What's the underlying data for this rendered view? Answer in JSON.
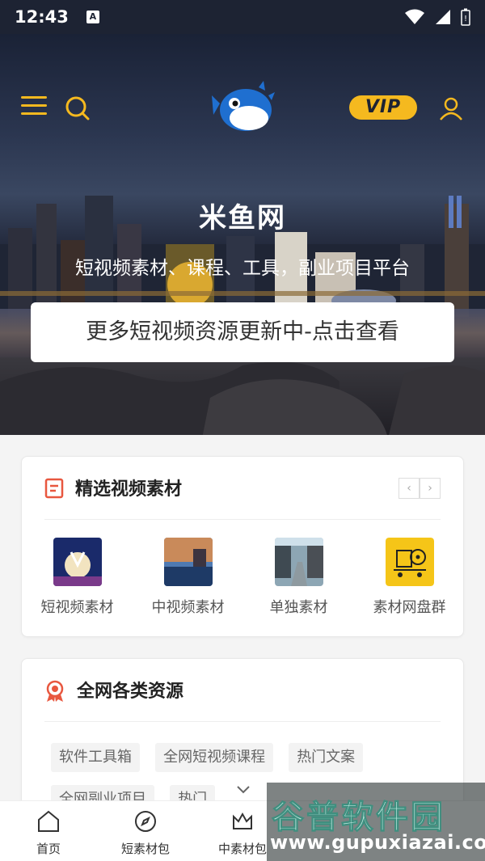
{
  "status_bar": {
    "time": "12:43",
    "indicator": "A"
  },
  "header": {
    "vip_label": "VIP"
  },
  "hero": {
    "title": "米鱼网",
    "subtitle": "短视频素材、课程、工具，副业项目平台",
    "cta_label": "更多短视频资源更新中-点击查看"
  },
  "section_video": {
    "title": "精选视频素材",
    "prev_arrow": "‹",
    "next_arrow": "›",
    "items": [
      {
        "label": "短视频素材"
      },
      {
        "label": "中视频素材"
      },
      {
        "label": "单独素材"
      },
      {
        "label": "素材网盘群"
      }
    ]
  },
  "section_resources": {
    "title": "全网各类资源",
    "tags": [
      "软件工具箱",
      "全网短视频课程",
      "热门文案",
      "全网副业项目",
      "热门"
    ]
  },
  "tabbar": {
    "items": [
      {
        "label": "首页"
      },
      {
        "label": "短素材包"
      },
      {
        "label": "中素材包"
      }
    ]
  },
  "watermark": {
    "name": "谷普软件园",
    "url": "www.gupuxiazai.com"
  },
  "colors": {
    "accent": "#f5b91f",
    "status_bg": "#1d2333",
    "icon_red": "#e8573f"
  }
}
